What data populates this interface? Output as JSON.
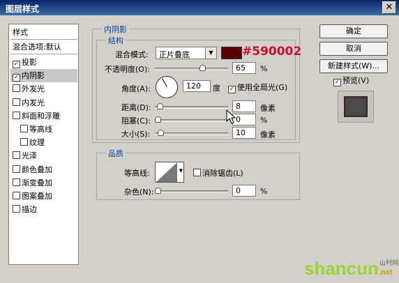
{
  "window": {
    "title": "图层样式",
    "close_glyph": "✕"
  },
  "sidebar": {
    "header": "样式",
    "blend_options": "混合选项:默认",
    "items": [
      {
        "label": "投影",
        "checked": true
      },
      {
        "label": "内阴影",
        "checked": true
      },
      {
        "label": "外发光",
        "checked": false
      },
      {
        "label": "内发光",
        "checked": false
      },
      {
        "label": "斜面和浮雕",
        "checked": false
      },
      {
        "label": "等高线",
        "checked": false
      },
      {
        "label": "纹理",
        "checked": false
      },
      {
        "label": "光泽",
        "checked": false
      },
      {
        "label": "颜色叠加",
        "checked": false
      },
      {
        "label": "渐变叠加",
        "checked": false
      },
      {
        "label": "图案叠加",
        "checked": false
      },
      {
        "label": "描边",
        "checked": false
      }
    ]
  },
  "panel": {
    "title": "内阴影",
    "structure": {
      "title": "结构",
      "blend_mode_label": "混合模式:",
      "blend_mode_value": "正片叠底",
      "color_hex": "#590002",
      "color": "#590002",
      "opacity_label": "不透明度(O):",
      "opacity_value": "65",
      "opacity_unit": "%",
      "opacity_level": 0.65,
      "angle_label": "角度(A):",
      "angle_value": "120",
      "angle_unit": "度",
      "global_light_label": "使用全局光(G)",
      "global_light_checked": true,
      "distance_label": "距离(D):",
      "distance_value": "8",
      "distance_unit": "像素",
      "distance_level": 0.03,
      "choke_label": "阻塞(C):",
      "choke_value": "0",
      "choke_unit": "%",
      "choke_level": 0.0,
      "size_label": "大小(S):",
      "size_value": "10",
      "size_unit": "像素",
      "size_level": 0.04
    },
    "quality": {
      "title": "品质",
      "contour_label": "等高线:",
      "antialias_label": "消除锯齿(L)",
      "antialias_checked": false,
      "noise_label": "杂色(N):",
      "noise_value": "0",
      "noise_unit": "%",
      "noise_level": 0.0
    }
  },
  "buttons": {
    "ok": "确定",
    "cancel": "取消",
    "new_style": "新建样式(W)...",
    "preview_label": "预览(V)",
    "preview_checked": true
  },
  "watermark": {
    "text": "shancun",
    "subtext": ".net",
    "cn": "山村网"
  }
}
